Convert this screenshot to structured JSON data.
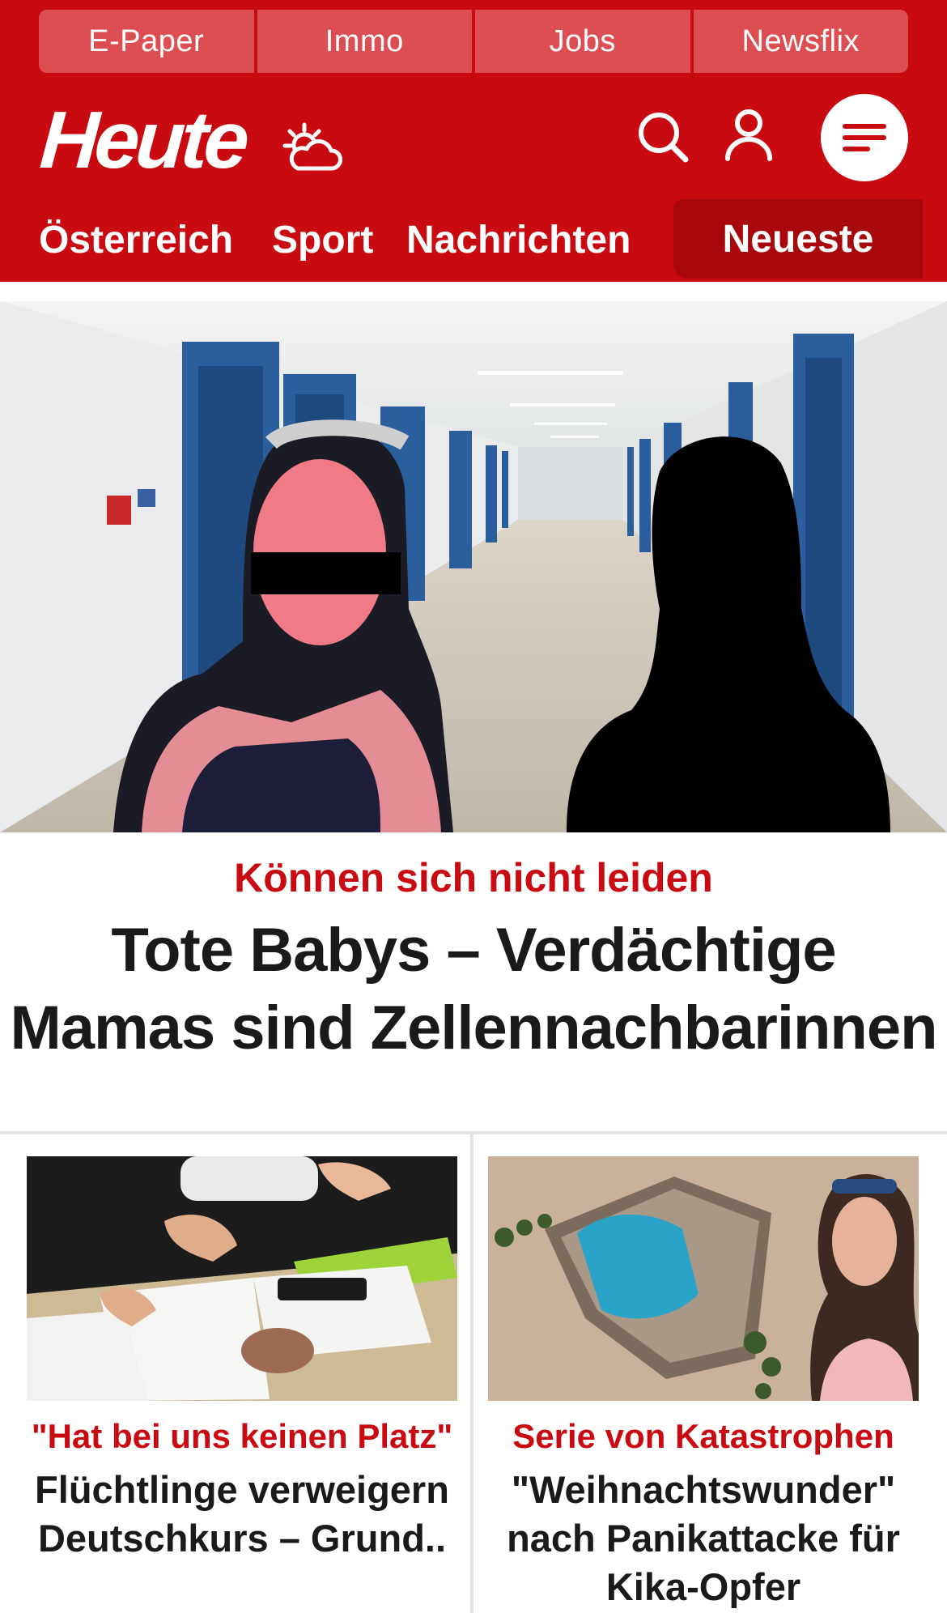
{
  "top_links": [
    "E-Paper",
    "Immo",
    "Jobs",
    "Newsflix"
  ],
  "brand": {
    "logo_text": "Heute",
    "accent": "#c90a10",
    "accent_dark": "#a8070c"
  },
  "nav": {
    "items": [
      "Österreich",
      "Sport",
      "Nachrichten"
    ],
    "active": "Neueste"
  },
  "icons": [
    "weather-icon",
    "search-icon",
    "user-icon",
    "menu-icon"
  ],
  "hero": {
    "kicker": "Können sich nicht leiden",
    "title": "Tote Babys – Verdächtige Mamas sind Zellennachbarinnen"
  },
  "cards": [
    {
      "kicker": "\"Hat bei uns keinen Platz\"",
      "title": "Flüchtlinge verweigern Deutschkurs – Grund.."
    },
    {
      "kicker": "Serie von Katastrophen",
      "title": "\"Weihnachtswunder\" nach Panikattacke für Kika-Opfer"
    }
  ]
}
